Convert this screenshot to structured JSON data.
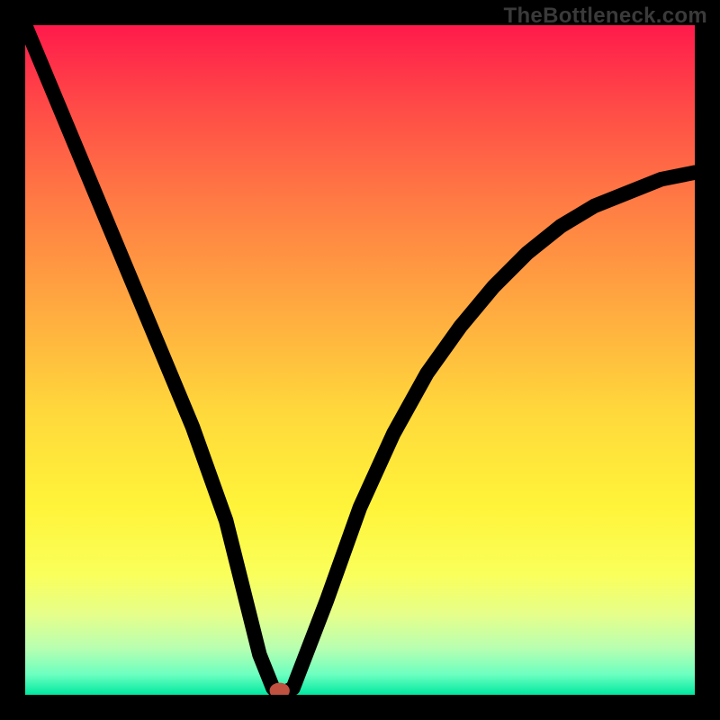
{
  "watermark": "TheBottleneck.com",
  "chart_data": {
    "type": "line",
    "title": "",
    "xlabel": "",
    "ylabel": "",
    "xlim": [
      0,
      100
    ],
    "ylim": [
      0,
      100
    ],
    "grid": false,
    "series": [
      {
        "name": "curve",
        "x": [
          0,
          5,
          10,
          15,
          20,
          25,
          30,
          33,
          35,
          37,
          38,
          40,
          45,
          50,
          55,
          60,
          65,
          70,
          75,
          80,
          85,
          90,
          95,
          100
        ],
        "y": [
          100,
          88,
          76,
          64,
          52,
          40,
          26,
          14,
          6,
          1,
          0,
          1,
          14,
          28,
          39,
          48,
          55,
          61,
          66,
          70,
          73,
          75,
          77,
          78
        ]
      }
    ],
    "marker": {
      "x": 38,
      "y": 0
    },
    "colors": {
      "gradient_top": "#ff1a4b",
      "gradient_bottom": "#00e8a0",
      "curve": "#000000",
      "marker": "#c05040",
      "frame": "#000000"
    }
  }
}
